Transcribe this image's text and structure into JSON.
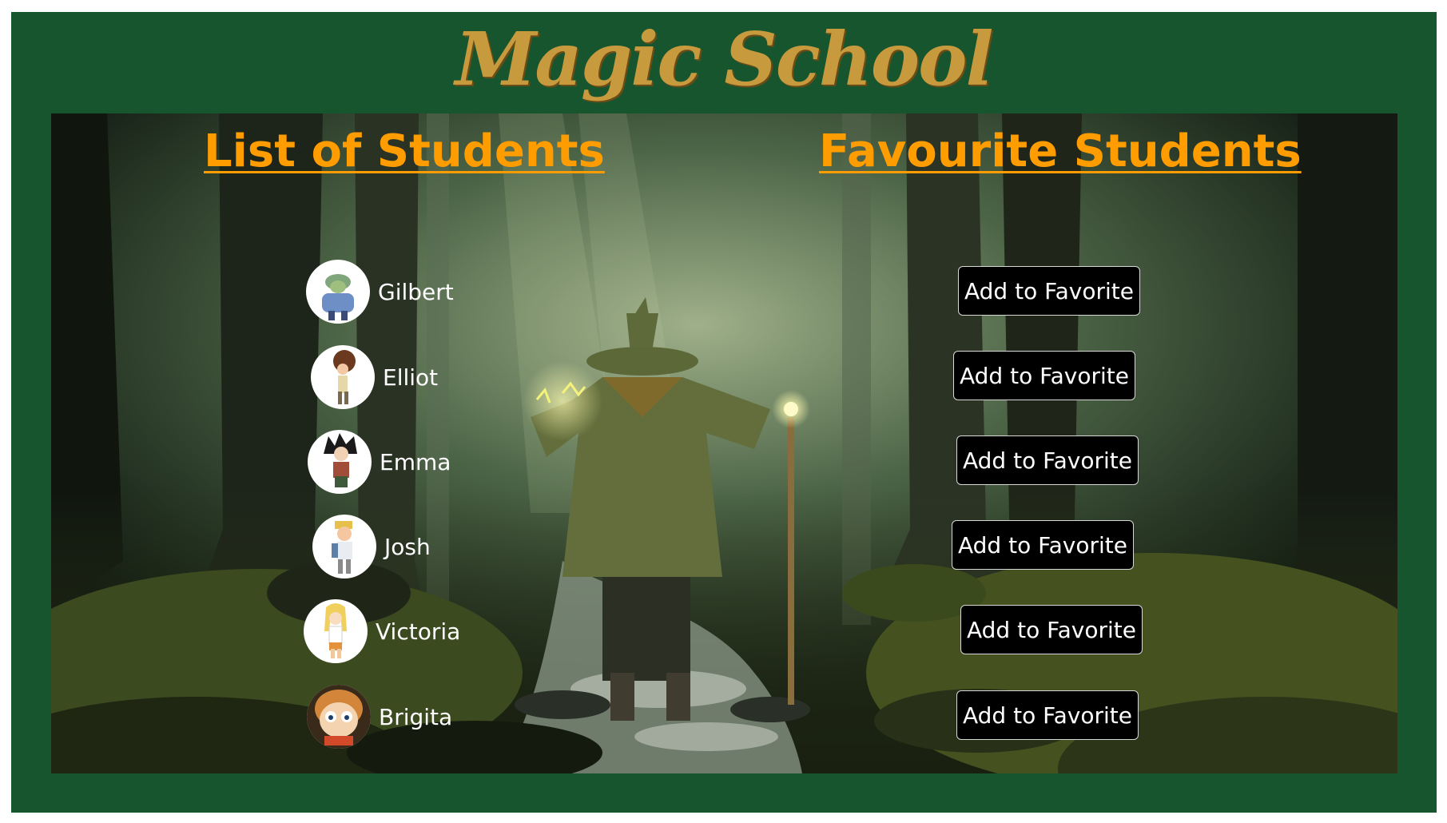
{
  "app": {
    "logo_text": "Magic School"
  },
  "sections": {
    "students_heading": "List of Students",
    "favourites_heading": "Favourite Students"
  },
  "students": [
    {
      "name": "Gilbert",
      "button_label": "Add to Favorite"
    },
    {
      "name": "Elliot",
      "button_label": "Add to Favorite"
    },
    {
      "name": "Emma",
      "button_label": "Add to Favorite"
    },
    {
      "name": "Josh",
      "button_label": "Add to Favorite"
    },
    {
      "name": "Victoria",
      "button_label": "Add to Favorite"
    },
    {
      "name": "Brigita",
      "button_label": "Add to Favorite"
    }
  ],
  "colors": {
    "frame": "#17552f",
    "logo": "#c89a3e",
    "heading": "#ff9c00",
    "button_bg": "#000000",
    "text": "#ffffff"
  }
}
